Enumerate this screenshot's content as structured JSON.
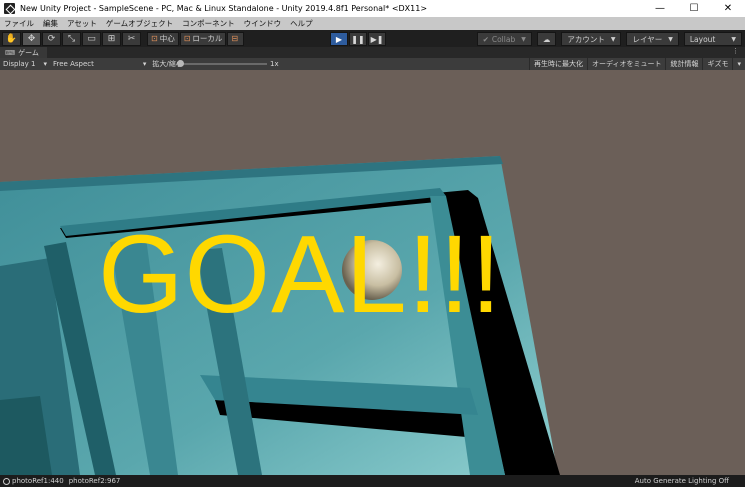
{
  "window": {
    "title": "New Unity Project - SampleScene - PC, Mac & Linux Standalone - Unity 2019.4.8f1 Personal* <DX11>",
    "minimize": "—",
    "maximize": "☐",
    "close": "✕"
  },
  "menu": [
    "ファイル",
    "編集",
    "アセット",
    "ゲームオブジェクト",
    "コンポーネント",
    "ウインドウ",
    "ヘルプ"
  ],
  "toolbar": {
    "tools": [
      "✋",
      "✥",
      "⟳",
      "⤡",
      "▭",
      "⊞",
      "✂"
    ],
    "pivot_label": "中心",
    "space_label": "ローカル",
    "play": "▶",
    "pause": "❚❚",
    "step": "▶❚",
    "collab_label": "Collab",
    "cloud_icon": "☁",
    "account_label": "アカウント",
    "layers_label": "レイヤー",
    "layout_label": "Layout"
  },
  "tabs": {
    "game_tab": "ゲーム",
    "menu_icon": "⋮"
  },
  "game_bar": {
    "display": "Display 1",
    "aspect": "Free Aspect",
    "scale_label": "拡大/縮小",
    "scale_value": "1x",
    "maximize_on_play": "再生時に最大化",
    "mute_audio": "オーディオをミュート",
    "stats": "統計情報",
    "gizmos": "ギズモ"
  },
  "scene": {
    "goal_text": "GOAL!!!"
  },
  "status": {
    "photo_ref1": "photoRef1:440",
    "photo_ref2": "photoRef2:967",
    "lighting": "Auto Generate Lighting Off"
  },
  "colors": {
    "background": "#6b5f58",
    "floor": "#4a9aa4",
    "goal_text": "#ffd800"
  }
}
